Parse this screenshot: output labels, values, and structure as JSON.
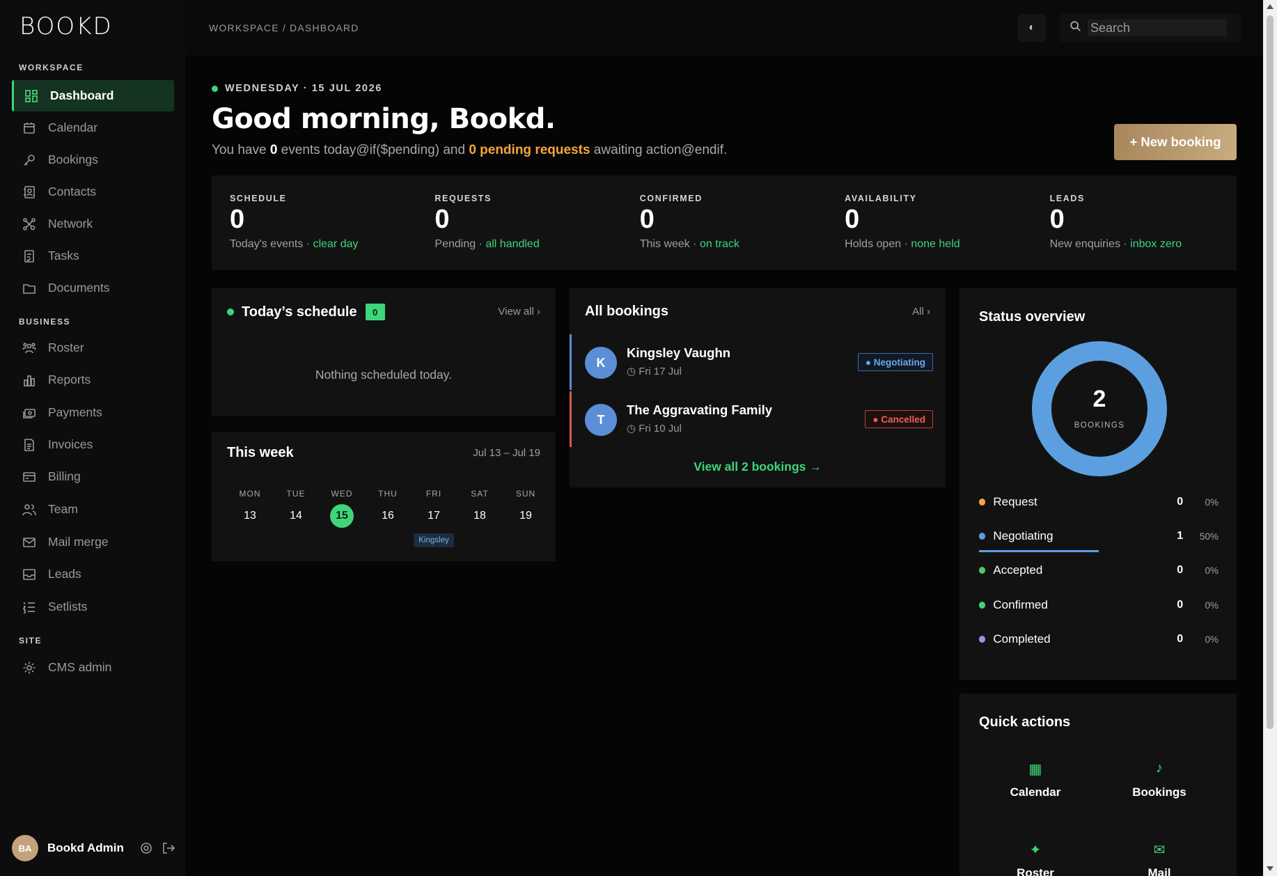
{
  "app": {
    "logo": "BOOKD"
  },
  "sidebar": {
    "sections": [
      {
        "label": "WORKSPACE"
      },
      {
        "label": "BUSINESS"
      },
      {
        "label": "SITE"
      }
    ],
    "workspace": [
      "Dashboard",
      "Calendar",
      "Bookings",
      "Contacts",
      "Network",
      "Tasks",
      "Documents"
    ],
    "business": [
      "Roster",
      "Reports",
      "Payments",
      "Invoices",
      "Billing",
      "Team",
      "Mail merge",
      "Leads",
      "Setlists"
    ],
    "site": [
      "CMS admin"
    ],
    "active": "Dashboard",
    "user": {
      "initials": "BA",
      "name": "Bookd Admin"
    }
  },
  "header": {
    "breadcrumb": "WORKSPACE / DASHBOARD",
    "theme_icon": "◐",
    "search_placeholder": "Search"
  },
  "greeting": {
    "date": "WEDNESDAY · 15 JUL 2026",
    "title": "Good morning, Bookd.",
    "sub_prefix": "You have ",
    "sub_events": "0",
    "sub_middle": " events today@if($pending) and ",
    "sub_pending": "0 pending requests",
    "sub_suffix": " awaiting action@endif.",
    "new_booking": "+ New booking"
  },
  "stats": [
    {
      "label": "SCHEDULE",
      "value": "0",
      "sub": "Today's events · ",
      "status": "clear day"
    },
    {
      "label": "REQUESTS",
      "value": "0",
      "sub": "Pending · ",
      "status": "all handled"
    },
    {
      "label": "CONFIRMED",
      "value": "0",
      "sub": "This week · ",
      "status": "on track"
    },
    {
      "label": "AVAILABILITY",
      "value": "0",
      "sub": "Holds open · ",
      "status": "none held"
    },
    {
      "label": "LEADS",
      "value": "0",
      "sub": "New enquiries · ",
      "status": "inbox zero"
    }
  ],
  "schedule": {
    "title": "Today’s schedule",
    "count": "0",
    "view_all": "View all ›",
    "empty": "Nothing scheduled today."
  },
  "week": {
    "title": "This week",
    "range": "Jul 13 – Jul 19",
    "days": [
      {
        "name": "MON",
        "num": "13"
      },
      {
        "name": "TUE",
        "num": "14"
      },
      {
        "name": "WED",
        "num": "15"
      },
      {
        "name": "THU",
        "num": "16"
      },
      {
        "name": "FRI",
        "num": "17"
      },
      {
        "name": "SAT",
        "num": "18"
      },
      {
        "name": "SUN",
        "num": "19"
      }
    ],
    "event_label": "Kingsley"
  },
  "bookings": {
    "title": "All bookings",
    "all_link": "All ›",
    "items": [
      {
        "initial": "K",
        "name": "Kingsley Vaughn",
        "date": "◷ Fri 17 Jul",
        "status": "● Negotiating"
      },
      {
        "initial": "T",
        "name": "The Aggravating Family",
        "date": "◷ Fri 10 Jul",
        "status": "● Cancelled"
      }
    ],
    "view_all": "View all 2 bookings →"
  },
  "status_overview": {
    "title": "Status overview",
    "total": "2",
    "total_label": "BOOKINGS",
    "rows": [
      {
        "name": "Request",
        "count": "0",
        "pct": "0%",
        "color": "#f4a63a"
      },
      {
        "name": "Negotiating",
        "count": "1",
        "pct": "50%",
        "color": "#5b9fe0"
      },
      {
        "name": "Accepted",
        "count": "0",
        "pct": "0%",
        "color": "#56c46a"
      },
      {
        "name": "Confirmed",
        "count": "0",
        "pct": "0%",
        "color": "#3fd57a"
      },
      {
        "name": "Completed",
        "count": "0",
        "pct": "0%",
        "color": "#a48be8"
      }
    ]
  },
  "quick_actions": {
    "title": "Quick actions",
    "items": [
      {
        "icon": "▦",
        "label": "Calendar"
      },
      {
        "icon": "♪",
        "label": "Bookings"
      },
      {
        "icon": "✦",
        "label": "Roster"
      },
      {
        "icon": "✉",
        "label": "Mail"
      }
    ]
  },
  "colors": {
    "accent": "#3fd57a",
    "gold": "#c4a27b",
    "blue": "#5b8ed6",
    "orange": "#f4a63a",
    "red": "#ef5d5d"
  }
}
